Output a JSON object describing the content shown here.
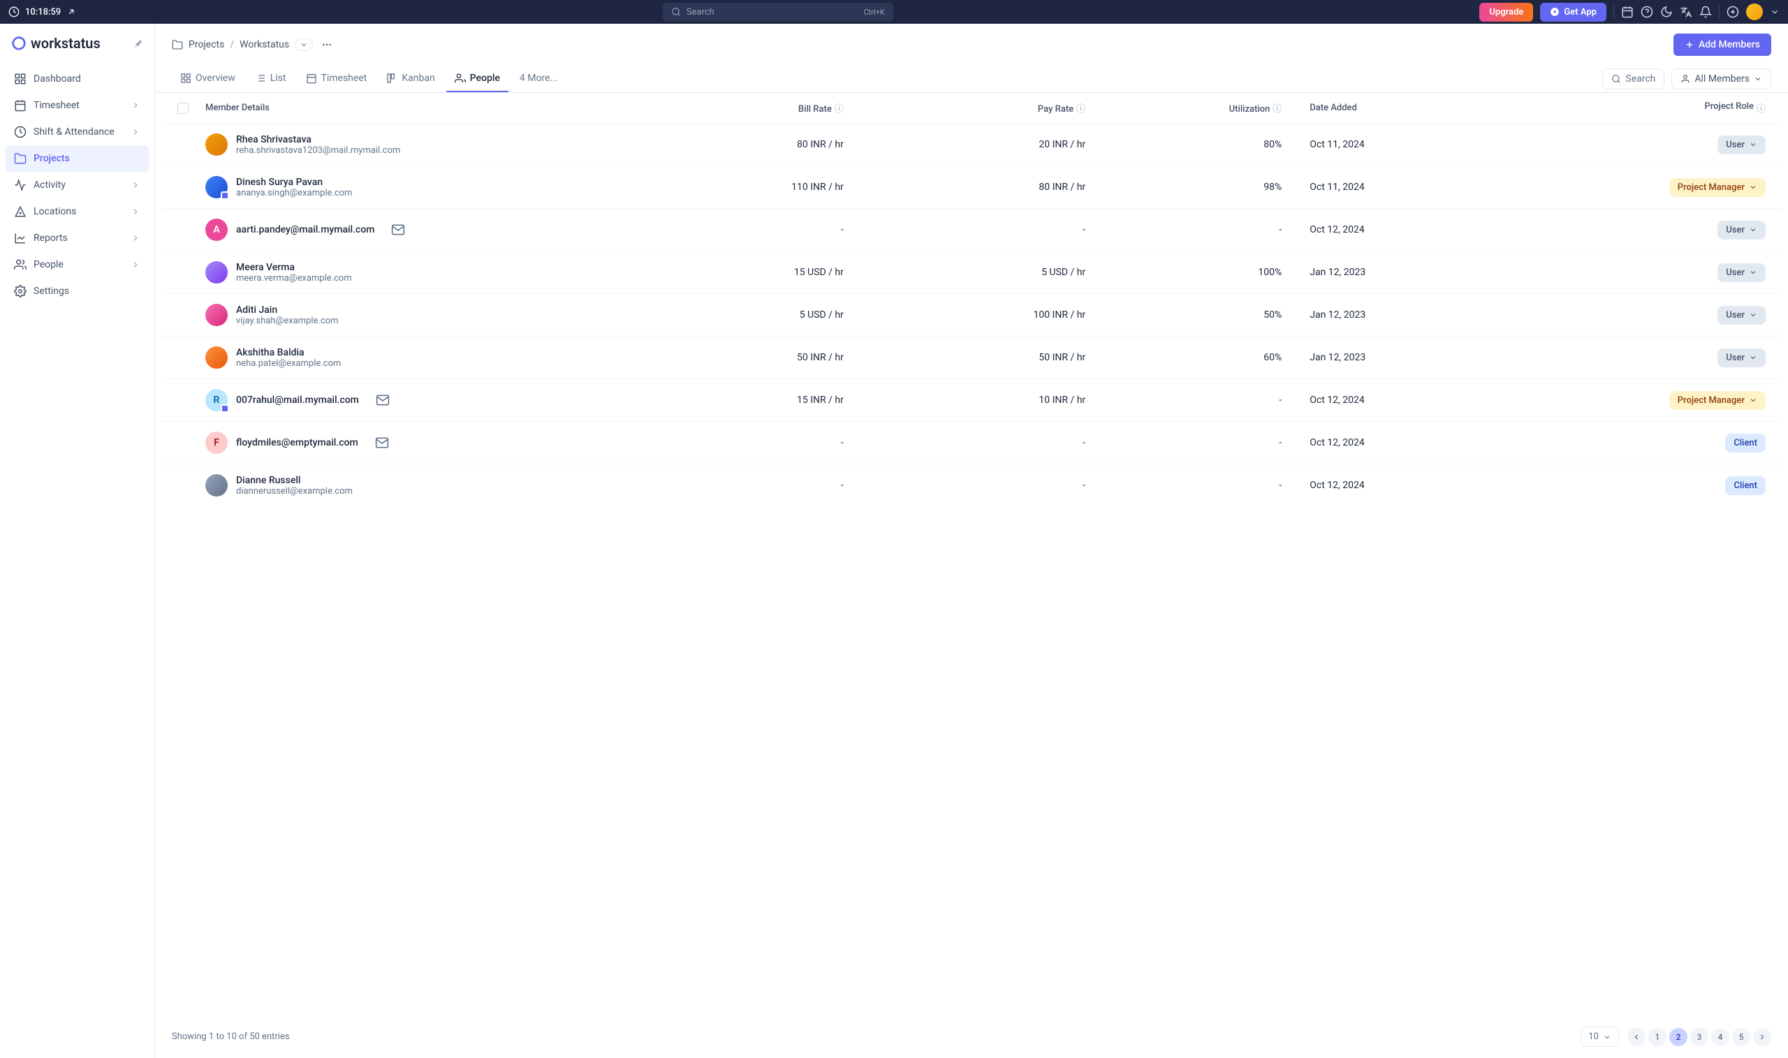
{
  "topbar": {
    "timer": "10:18:59",
    "search_placeholder": "Search",
    "search_kbd": "Ctrl+K",
    "upgrade": "Upgrade",
    "get_app": "Get App"
  },
  "logo": {
    "text": "workstatus"
  },
  "sidebar": {
    "items": [
      {
        "label": "Dashboard"
      },
      {
        "label": "Timesheet",
        "chev": true
      },
      {
        "label": "Shift & Attendance",
        "chev": true
      },
      {
        "label": "Projects",
        "active": true
      },
      {
        "label": "Activity",
        "chev": true
      },
      {
        "label": "Locations",
        "chev": true
      },
      {
        "label": "Reports",
        "chev": true
      },
      {
        "label": "People",
        "chev": true
      },
      {
        "label": "Settings"
      }
    ]
  },
  "breadcrumb": {
    "root": "Projects",
    "current": "Workstatus"
  },
  "add_members": "Add Members",
  "tabs": {
    "items": [
      {
        "label": "Overview"
      },
      {
        "label": "List"
      },
      {
        "label": "Timesheet"
      },
      {
        "label": "Kanban"
      },
      {
        "label": "People",
        "active": true
      },
      {
        "label": "4 More..."
      }
    ],
    "search": "Search",
    "filter": "All Members"
  },
  "columns": {
    "member": "Member Details",
    "bill": "Bill Rate",
    "pay": "Pay Rate",
    "util": "Utilization",
    "date": "Date Added",
    "role": "Project Role"
  },
  "roles": {
    "user": "User",
    "pm": "Project Manager",
    "client": "Client"
  },
  "rows": [
    {
      "name": "Rhea Shrivastava",
      "email": "reha.shrivastava1203@mail.mymail.com",
      "bill": "80 INR / hr",
      "pay": "20 INR / hr",
      "util": "80%",
      "date": "Oct 11, 2024",
      "role": "user",
      "avatar": "img1"
    },
    {
      "name": "Dinesh Surya Pavan",
      "email": "ananya.singh@example.com",
      "bill": "110 INR / hr",
      "pay": "80 INR / hr",
      "util": "98%",
      "date": "Oct 11, 2024",
      "role": "pm",
      "avatar": "img2",
      "badge": true
    },
    {
      "name": "",
      "email": "aarti.pandey@mail.mymail.com",
      "bill": "-",
      "pay": "-",
      "util": "-",
      "date": "Oct 12, 2024",
      "role": "user",
      "avatar": "img3",
      "initial": "A",
      "mail": true
    },
    {
      "name": "Meera Verma",
      "email": "meera.verma@example.com",
      "bill": "15 USD / hr",
      "pay": "5 USD / hr",
      "util": "100%",
      "date": "Jan 12, 2023",
      "role": "user",
      "avatar": "img4"
    },
    {
      "name": "Aditi Jain",
      "email": "vijay.shah@example.com",
      "bill": "5 USD / hr",
      "pay": "100 INR / hr",
      "util": "50%",
      "date": "Jan 12, 2023",
      "role": "user",
      "avatar": "img5"
    },
    {
      "name": "Akshitha Baldia",
      "email": "neha.patel@example.com",
      "bill": "50 INR / hr",
      "pay": "50 INR / hr",
      "util": "60%",
      "date": "Jan 12, 2023",
      "role": "user",
      "avatar": "img6"
    },
    {
      "name": "",
      "email": "007rahul@mail.mymail.com",
      "bill": "15 INR / hr",
      "pay": "10 INR / hr",
      "util": "-",
      "date": "Oct 12, 2024",
      "role": "pm",
      "avatar": "img7",
      "initial": "R",
      "badge": true,
      "mail": true
    },
    {
      "name": "",
      "email": "floydmiles@emptymail.com",
      "bill": "-",
      "pay": "-",
      "util": "-",
      "date": "Oct 12, 2024",
      "role": "client",
      "avatar": "img8",
      "initial": "F",
      "mail": true
    },
    {
      "name": "Dianne Russell",
      "email": "diannerussell@example.com",
      "bill": "-",
      "pay": "-",
      "util": "-",
      "date": "Oct 12, 2024",
      "role": "client",
      "avatar": "img9"
    }
  ],
  "footer": {
    "showing": "Showing 1 to 10 of 50 entries",
    "page_size": "10",
    "pages": [
      "1",
      "2",
      "3",
      "4",
      "5"
    ],
    "active_page": "2"
  }
}
